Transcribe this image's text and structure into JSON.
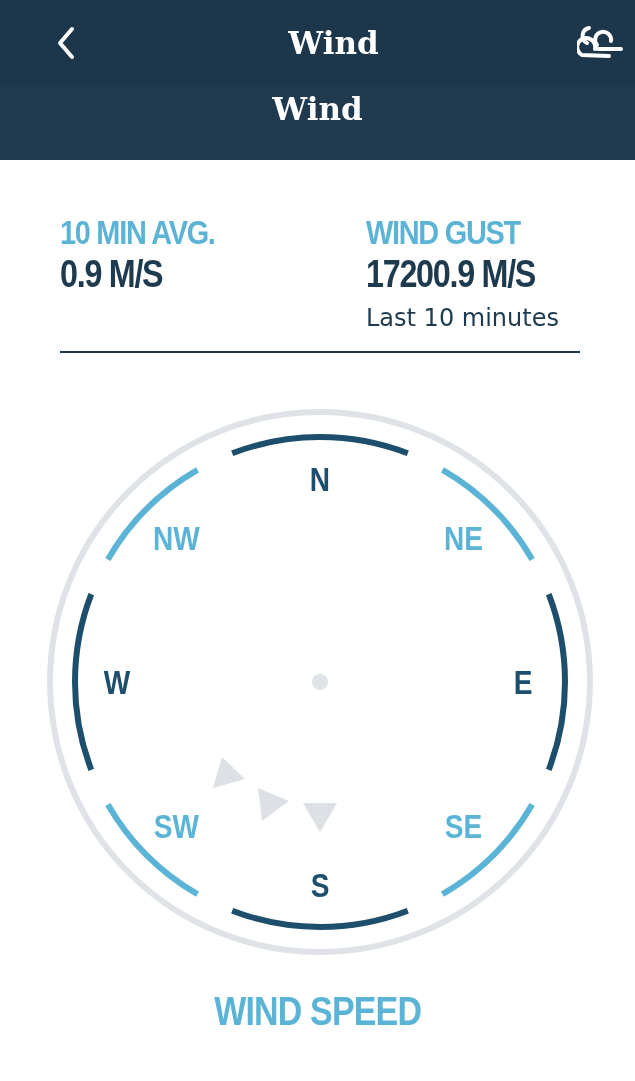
{
  "header": {
    "title": "Wind",
    "subtitle": "Wind"
  },
  "stats": [
    {
      "label": "10 MIN AVG.",
      "value": "0.9 M/S"
    },
    {
      "label": "WIND GUST",
      "value": "17200.9 M/S",
      "note": "Last 10 minutes"
    }
  ],
  "compass": {
    "points": [
      {
        "label": "N",
        "kind": "cardinal"
      },
      {
        "label": "NE",
        "kind": "intercardinal"
      },
      {
        "label": "E",
        "kind": "cardinal"
      },
      {
        "label": "SE",
        "kind": "intercardinal"
      },
      {
        "label": "S",
        "kind": "cardinal"
      },
      {
        "label": "SW",
        "kind": "intercardinal"
      },
      {
        "label": "W",
        "kind": "cardinal"
      },
      {
        "label": "NW",
        "kind": "intercardinal"
      }
    ]
  },
  "section_title": "WIND SPEED"
}
